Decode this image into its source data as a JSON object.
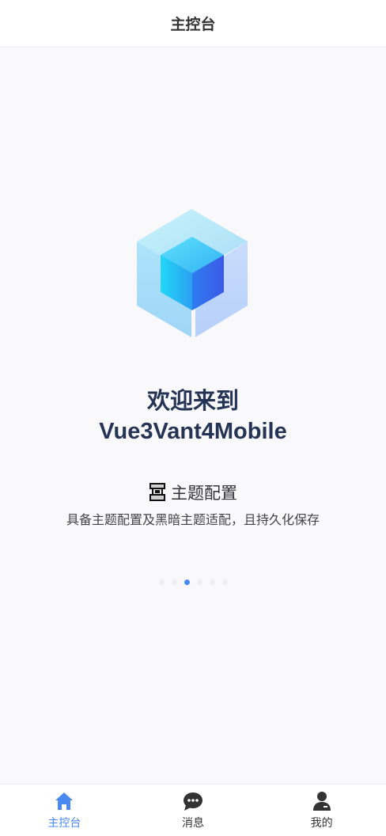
{
  "header": {
    "title": "主控台"
  },
  "hero": {
    "welcome_line1": "欢迎来到",
    "welcome_line2": "Vue3Vant4Mobile"
  },
  "feature": {
    "icon": "theme-config-icon",
    "title": "主题配置",
    "description": "具备主题配置及黑暗主题适配，且持久化保存"
  },
  "carousel": {
    "total": 6,
    "active_index": 2
  },
  "tabbar": {
    "items": [
      {
        "label": "主控台",
        "icon": "home-icon",
        "active": true
      },
      {
        "label": "消息",
        "icon": "chat-bubble-icon",
        "active": false
      },
      {
        "label": "我的",
        "icon": "user-icon",
        "active": false
      }
    ]
  },
  "colors": {
    "accent": "#4a8af0",
    "title_text": "#253455",
    "background": "#f9f8fb"
  }
}
